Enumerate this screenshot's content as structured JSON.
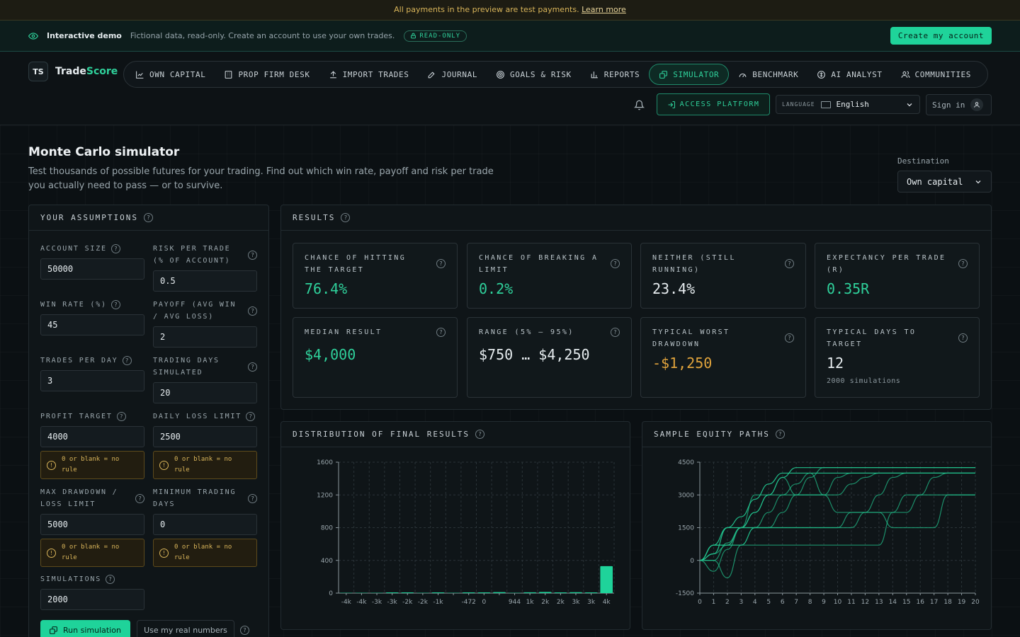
{
  "payments": {
    "text": "All payments in the preview are test payments.",
    "link": "Learn more"
  },
  "demo": {
    "title": "Interactive demo",
    "desc": "Fictional data, read-only. Create an account to use your own trades.",
    "badge": "READ-ONLY",
    "create": "Create my account"
  },
  "brand": {
    "mark": "TS",
    "name_a": "Trade",
    "name_b": "Score"
  },
  "nav": [
    {
      "label": "OWN CAPITAL",
      "icon": "chart-line-icon"
    },
    {
      "label": "PROP FIRM DESK",
      "icon": "building-icon"
    },
    {
      "label": "IMPORT TRADES",
      "icon": "upload-icon"
    },
    {
      "label": "JOURNAL",
      "icon": "edit-icon"
    },
    {
      "label": "GOALS & RISK",
      "icon": "target-icon"
    },
    {
      "label": "REPORTS",
      "icon": "bar-chart-icon"
    },
    {
      "label": "SIMULATOR",
      "icon": "dice-icon",
      "active": true
    },
    {
      "label": "BENCHMARK",
      "icon": "gauge-icon"
    },
    {
      "label": "AI ANALYST",
      "icon": "brain-icon"
    },
    {
      "label": "COMMUNITIES",
      "icon": "users-icon"
    }
  ],
  "header": {
    "access": "ACCESS PLATFORM",
    "lang_label": "LANGUAGE",
    "lang_value": "English",
    "signin": "Sign in"
  },
  "page": {
    "title": "Monte Carlo simulator",
    "subtitle": "Test thousands of possible futures for your trading. Find out which win rate, payoff and risk per trade you actually need to pass — or to survive.",
    "dest_label": "Destination",
    "dest_value": "Own capital"
  },
  "assumptions": {
    "title": "YOUR ASSUMPTIONS",
    "account_size": {
      "label": "ACCOUNT SIZE",
      "value": "50000"
    },
    "risk": {
      "label": "RISK PER TRADE (% OF ACCOUNT)",
      "value": "0.5"
    },
    "win_rate": {
      "label": "WIN RATE (%)",
      "value": "45"
    },
    "payoff": {
      "label": "PAYOFF (AVG WIN / AVG LOSS)",
      "value": "2"
    },
    "trades_day": {
      "label": "TRADES PER DAY",
      "value": "3"
    },
    "days_sim": {
      "label": "TRADING DAYS SIMULATED",
      "value": "20"
    },
    "profit_target": {
      "label": "PROFIT TARGET",
      "value": "4000"
    },
    "daily_loss": {
      "label": "DAILY LOSS LIMIT",
      "value": "2500"
    },
    "max_dd": {
      "label": "MAX DRAWDOWN / LOSS LIMIT",
      "value": "5000"
    },
    "min_days": {
      "label": "MINIMUM TRADING DAYS",
      "value": "0"
    },
    "simulations": {
      "label": "SIMULATIONS",
      "value": "2000"
    },
    "rule_note": "0 or blank = no rule",
    "run": "Run simulation",
    "real": "Use my real numbers"
  },
  "results": {
    "title": "RESULTS",
    "cards": [
      {
        "label": "CHANCE OF HITTING THE TARGET",
        "value": "76.4%"
      },
      {
        "label": "CHANCE OF BREAKING A LIMIT",
        "value": "0.2%"
      },
      {
        "label": "NEITHER (STILL RUNNING)",
        "value": "23.4%"
      },
      {
        "label": "EXPECTANCY PER TRADE (R)",
        "value": "0.35R"
      },
      {
        "label": "MEDIAN RESULT",
        "value": "$4,000"
      },
      {
        "label": "RANGE (5% – 95%)",
        "value": "$750 … $4,250"
      },
      {
        "label": "TYPICAL WORST DRAWDOWN",
        "value": "-$1,250"
      },
      {
        "label": "TYPICAL DAYS TO TARGET",
        "value": "12",
        "sub": "2000 simulations"
      }
    ],
    "colors": {
      "positive": "#2fd19b",
      "warning": "#e0a33c",
      "accent": "#1fd39a"
    }
  },
  "chart_data": [
    {
      "type": "bar",
      "title": "DISTRIBUTION OF FINAL RESULTS",
      "categories": [
        "-4k",
        "-4k",
        "-3k",
        "-3k",
        "-2k",
        "-2k",
        "-1k",
        "",
        "-472",
        "0",
        "",
        "944",
        "1k",
        "2k",
        "2k",
        "3k",
        "3k",
        "4k"
      ],
      "values": [
        0,
        0,
        0,
        2,
        1,
        0,
        1,
        0,
        3,
        8,
        12,
        0,
        10,
        14,
        3,
        11,
        2,
        330
      ],
      "ylim": [
        0,
        1600
      ],
      "yticks": [
        0,
        400,
        800,
        1200,
        1600
      ],
      "grid": true
    },
    {
      "type": "line",
      "title": "SAMPLE EQUITY PATHS",
      "x": [
        0,
        1,
        2,
        3,
        4,
        5,
        6,
        7,
        8,
        9,
        10,
        11,
        12,
        13,
        14,
        15,
        16,
        17,
        18,
        19,
        20
      ],
      "ylim": [
        -1500,
        4500
      ],
      "yticks": [
        -1500,
        0,
        1500,
        3000,
        4500
      ],
      "grid": true,
      "series": [
        {
          "values": [
            0,
            300,
            1500,
            1500,
            2200,
            3000,
            3800,
            4250,
            4250,
            4250,
            4250,
            4250,
            4250,
            4250,
            4250,
            4250,
            4250,
            4250,
            4250,
            4250,
            4250
          ]
        },
        {
          "values": [
            0,
            700,
            1500,
            2000,
            2800,
            3500,
            4000,
            4000,
            4000,
            4000,
            4000,
            4000,
            4000,
            4000,
            4000,
            4000,
            4000,
            4000,
            4000,
            4000,
            4000
          ]
        },
        {
          "values": [
            0,
            0,
            800,
            1500,
            3000,
            3000,
            3800,
            3000,
            3800,
            4250,
            4250,
            4250,
            4250,
            4250,
            4250,
            4250,
            4250,
            4250,
            4250,
            4250,
            4250
          ]
        },
        {
          "values": [
            0,
            -500,
            500,
            1500,
            2200,
            3000,
            3000,
            3500,
            4000,
            3000,
            3800,
            4000,
            4000,
            4000,
            4000,
            4000,
            4000,
            4000,
            4000,
            4000,
            4000
          ]
        },
        {
          "values": [
            0,
            0,
            -800,
            700,
            1500,
            2200,
            3000,
            3000,
            3000,
            3000,
            3000,
            3500,
            3800,
            4000,
            4000,
            4000,
            4000,
            4000,
            4000,
            4000,
            4000
          ]
        },
        {
          "values": [
            0,
            700,
            700,
            1500,
            1500,
            1500,
            2200,
            3000,
            3000,
            3000,
            2200,
            2200,
            2200,
            3000,
            3800,
            4000,
            4000,
            4000,
            4000,
            4000,
            4000
          ]
        },
        {
          "values": [
            0,
            700,
            700,
            1500,
            1500,
            1500,
            1500,
            1500,
            1500,
            1500,
            1500,
            2200,
            2200,
            2200,
            2200,
            3000,
            3000,
            3000,
            3000,
            3000,
            3000
          ]
        },
        {
          "values": [
            0,
            700,
            700,
            700,
            1500,
            1500,
            1500,
            1500,
            1500,
            1500,
            1500,
            1500,
            2200,
            2200,
            1500,
            1500,
            1500,
            1500,
            3000,
            3000,
            3000
          ]
        },
        {
          "values": [
            0,
            300,
            700,
            700,
            700,
            700,
            700,
            700,
            700,
            700,
            700,
            700,
            700,
            700,
            2200,
            2200,
            3000,
            3800,
            4000,
            4000,
            4000
          ]
        }
      ]
    }
  ]
}
